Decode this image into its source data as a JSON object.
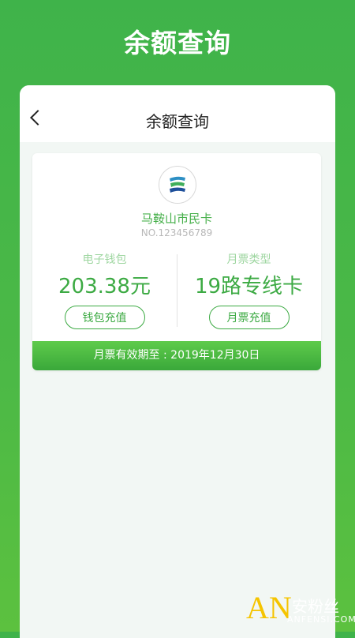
{
  "promo": {
    "title": "余额查询"
  },
  "navbar": {
    "title": "余额查询",
    "back_icon": "chevron-left-icon"
  },
  "card": {
    "logo_icon": "city-card-logo",
    "name": "马鞍山市民卡",
    "number": "NO.123456789",
    "wallet": {
      "label": "电子钱包",
      "value": "203.38元",
      "button": "钱包充值"
    },
    "monthly": {
      "label": "月票类型",
      "value": "19路专线卡",
      "button": "月票充值"
    },
    "expiry": "月票有效期至 : 2019年12月30日"
  },
  "watermark": {
    "logo": "AN",
    "name": "安粉丝",
    "domain": "ANFENSI.COM"
  },
  "colors": {
    "brand_green": "#3caa43",
    "background_green": "#47b646"
  }
}
